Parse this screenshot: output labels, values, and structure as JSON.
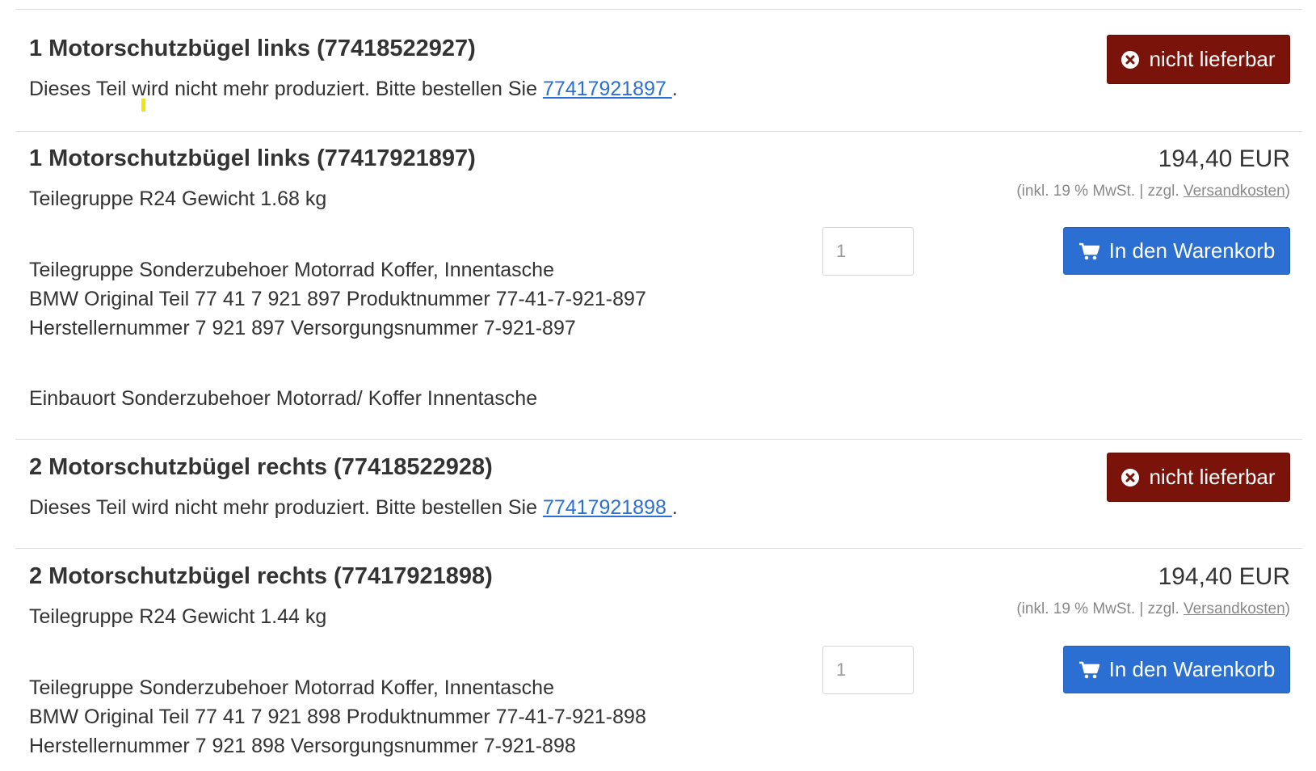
{
  "items": [
    {
      "title": "1 Motorschutzbügel links (77418522927)",
      "notice_prefix": "Dieses Teil wird nicht mehr produziert. Bitte bestellen Sie ",
      "replacement_link": "77417921897 ",
      "notice_suffix": ".",
      "status_label": "nicht lieferbar"
    },
    {
      "title": "1 Motorschutzbügel links (77417921897)",
      "subtitle": "Teilegruppe R24 Gewicht 1.68 kg",
      "price": "194,40 EUR",
      "tax_prefix": "(inkl. 19 % MwSt. | zzgl. ",
      "tax_link": "Versandkosten",
      "tax_suffix": ")",
      "qty_value": "1",
      "cart_label": "In den Warenkorb",
      "details": [
        "Teilegruppe Sonderzubehoer Motorrad Koffer, Innentasche",
        "BMW Original Teil 77 41 7 921 897 Produktnummer 77-41-7-921-897",
        "Herstellernummer 7 921 897 Versorgungsnummer 7-921-897"
      ],
      "location": "Einbauort Sonderzubehoer Motorrad/ Koffer Innentasche"
    },
    {
      "title": "2 Motorschutzbügel rechts (77418522928)",
      "notice_prefix": "Dieses Teil wird nicht mehr produziert. Bitte bestellen Sie ",
      "replacement_link": "77417921898 ",
      "notice_suffix": ".",
      "status_label": "nicht lieferbar"
    },
    {
      "title": "2 Motorschutzbügel rechts (77417921898)",
      "subtitle": "Teilegruppe R24 Gewicht 1.44 kg",
      "price": "194,40 EUR",
      "tax_prefix": "(inkl. 19 % MwSt. | zzgl. ",
      "tax_link": "Versandkosten",
      "tax_suffix": ")",
      "qty_value": "1",
      "cart_label": "In den Warenkorb",
      "details": [
        "Teilegruppe Sonderzubehoer Motorrad Koffer, Innentasche",
        "BMW Original Teil 77 41 7 921 898 Produktnummer 77-41-7-921-898",
        "Herstellernummer 7 921 898 Versorgungsnummer 7-921-898"
      ]
    }
  ],
  "icons": {
    "unavailable": "times-circle-icon",
    "cart": "shopping-cart-icon"
  },
  "colors": {
    "unavailable_button": "#7a1309",
    "cart_button": "#2b6fd2",
    "link": "#2a6fd6"
  }
}
